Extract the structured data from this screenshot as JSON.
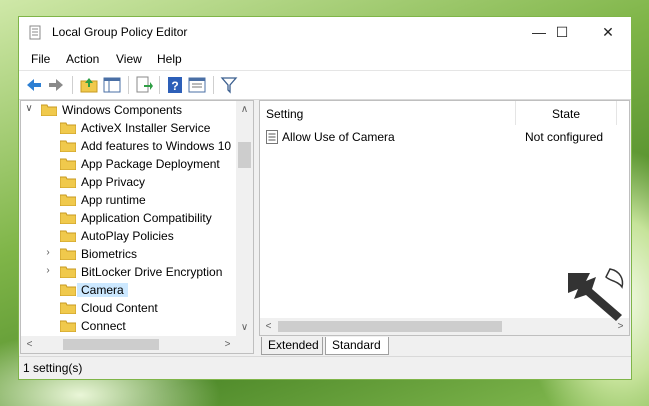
{
  "window": {
    "title": "Local Group Policy Editor",
    "controls": {
      "minimize": "—",
      "maximize": "☐",
      "close": "✕"
    }
  },
  "menu": [
    "File",
    "Action",
    "View",
    "Help"
  ],
  "toolbar": {
    "icons": [
      "back-icon",
      "forward-icon",
      "up-folder-icon",
      "show-hide-tree-icon",
      "export-list-icon",
      "help-icon",
      "properties-icon",
      "filter-icon"
    ]
  },
  "tree": {
    "root": "Windows Components",
    "items": [
      {
        "label": "ActiveX Installer Service",
        "expandable": false
      },
      {
        "label": "Add features to Windows 10",
        "expandable": false
      },
      {
        "label": "App Package Deployment",
        "expandable": false
      },
      {
        "label": "App Privacy",
        "expandable": false
      },
      {
        "label": "App runtime",
        "expandable": false
      },
      {
        "label": "Application Compatibility",
        "expandable": false
      },
      {
        "label": "AutoPlay Policies",
        "expandable": false
      },
      {
        "label": "Biometrics",
        "expandable": true
      },
      {
        "label": "BitLocker Drive Encryption",
        "expandable": true
      },
      {
        "label": "Camera",
        "expandable": false,
        "selected": true
      },
      {
        "label": "Cloud Content",
        "expandable": false
      },
      {
        "label": "Connect",
        "expandable": false
      }
    ]
  },
  "details": {
    "columns": {
      "setting": "Setting",
      "state": "State"
    },
    "rows": [
      {
        "setting": "Allow Use of Camera",
        "state": "Not configured"
      }
    ]
  },
  "tabs": {
    "extended": "Extended",
    "standard": "Standard"
  },
  "status": {
    "text": "1 setting(s)"
  },
  "colors": {
    "accent_green": "#7fb548",
    "selection": "#cce8ff",
    "folder": "#f0c94c"
  }
}
